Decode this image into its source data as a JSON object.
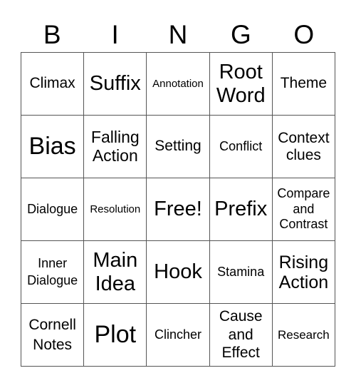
{
  "header": {
    "letters": [
      "B",
      "I",
      "N",
      "G",
      "O"
    ]
  },
  "grid": {
    "rows": [
      [
        "Climax",
        "Suffix",
        "Annotation",
        "Root\nWord",
        "Theme"
      ],
      [
        "Bias",
        "Falling\nAction",
        "Setting",
        "Conflict",
        "Context\nclues"
      ],
      [
        "Dialogue",
        "Resolution",
        "Free!",
        "Prefix",
        "Compare\nand\nContrast"
      ],
      [
        "Inner\nDialogue",
        "Main\nIdea",
        "Hook",
        "Stamina",
        "Rising\nAction"
      ],
      [
        "Cornell\nNotes",
        "Plot",
        "Clincher",
        "Cause\nand\nEffect",
        "Research"
      ]
    ],
    "free_space": "Free!"
  }
}
